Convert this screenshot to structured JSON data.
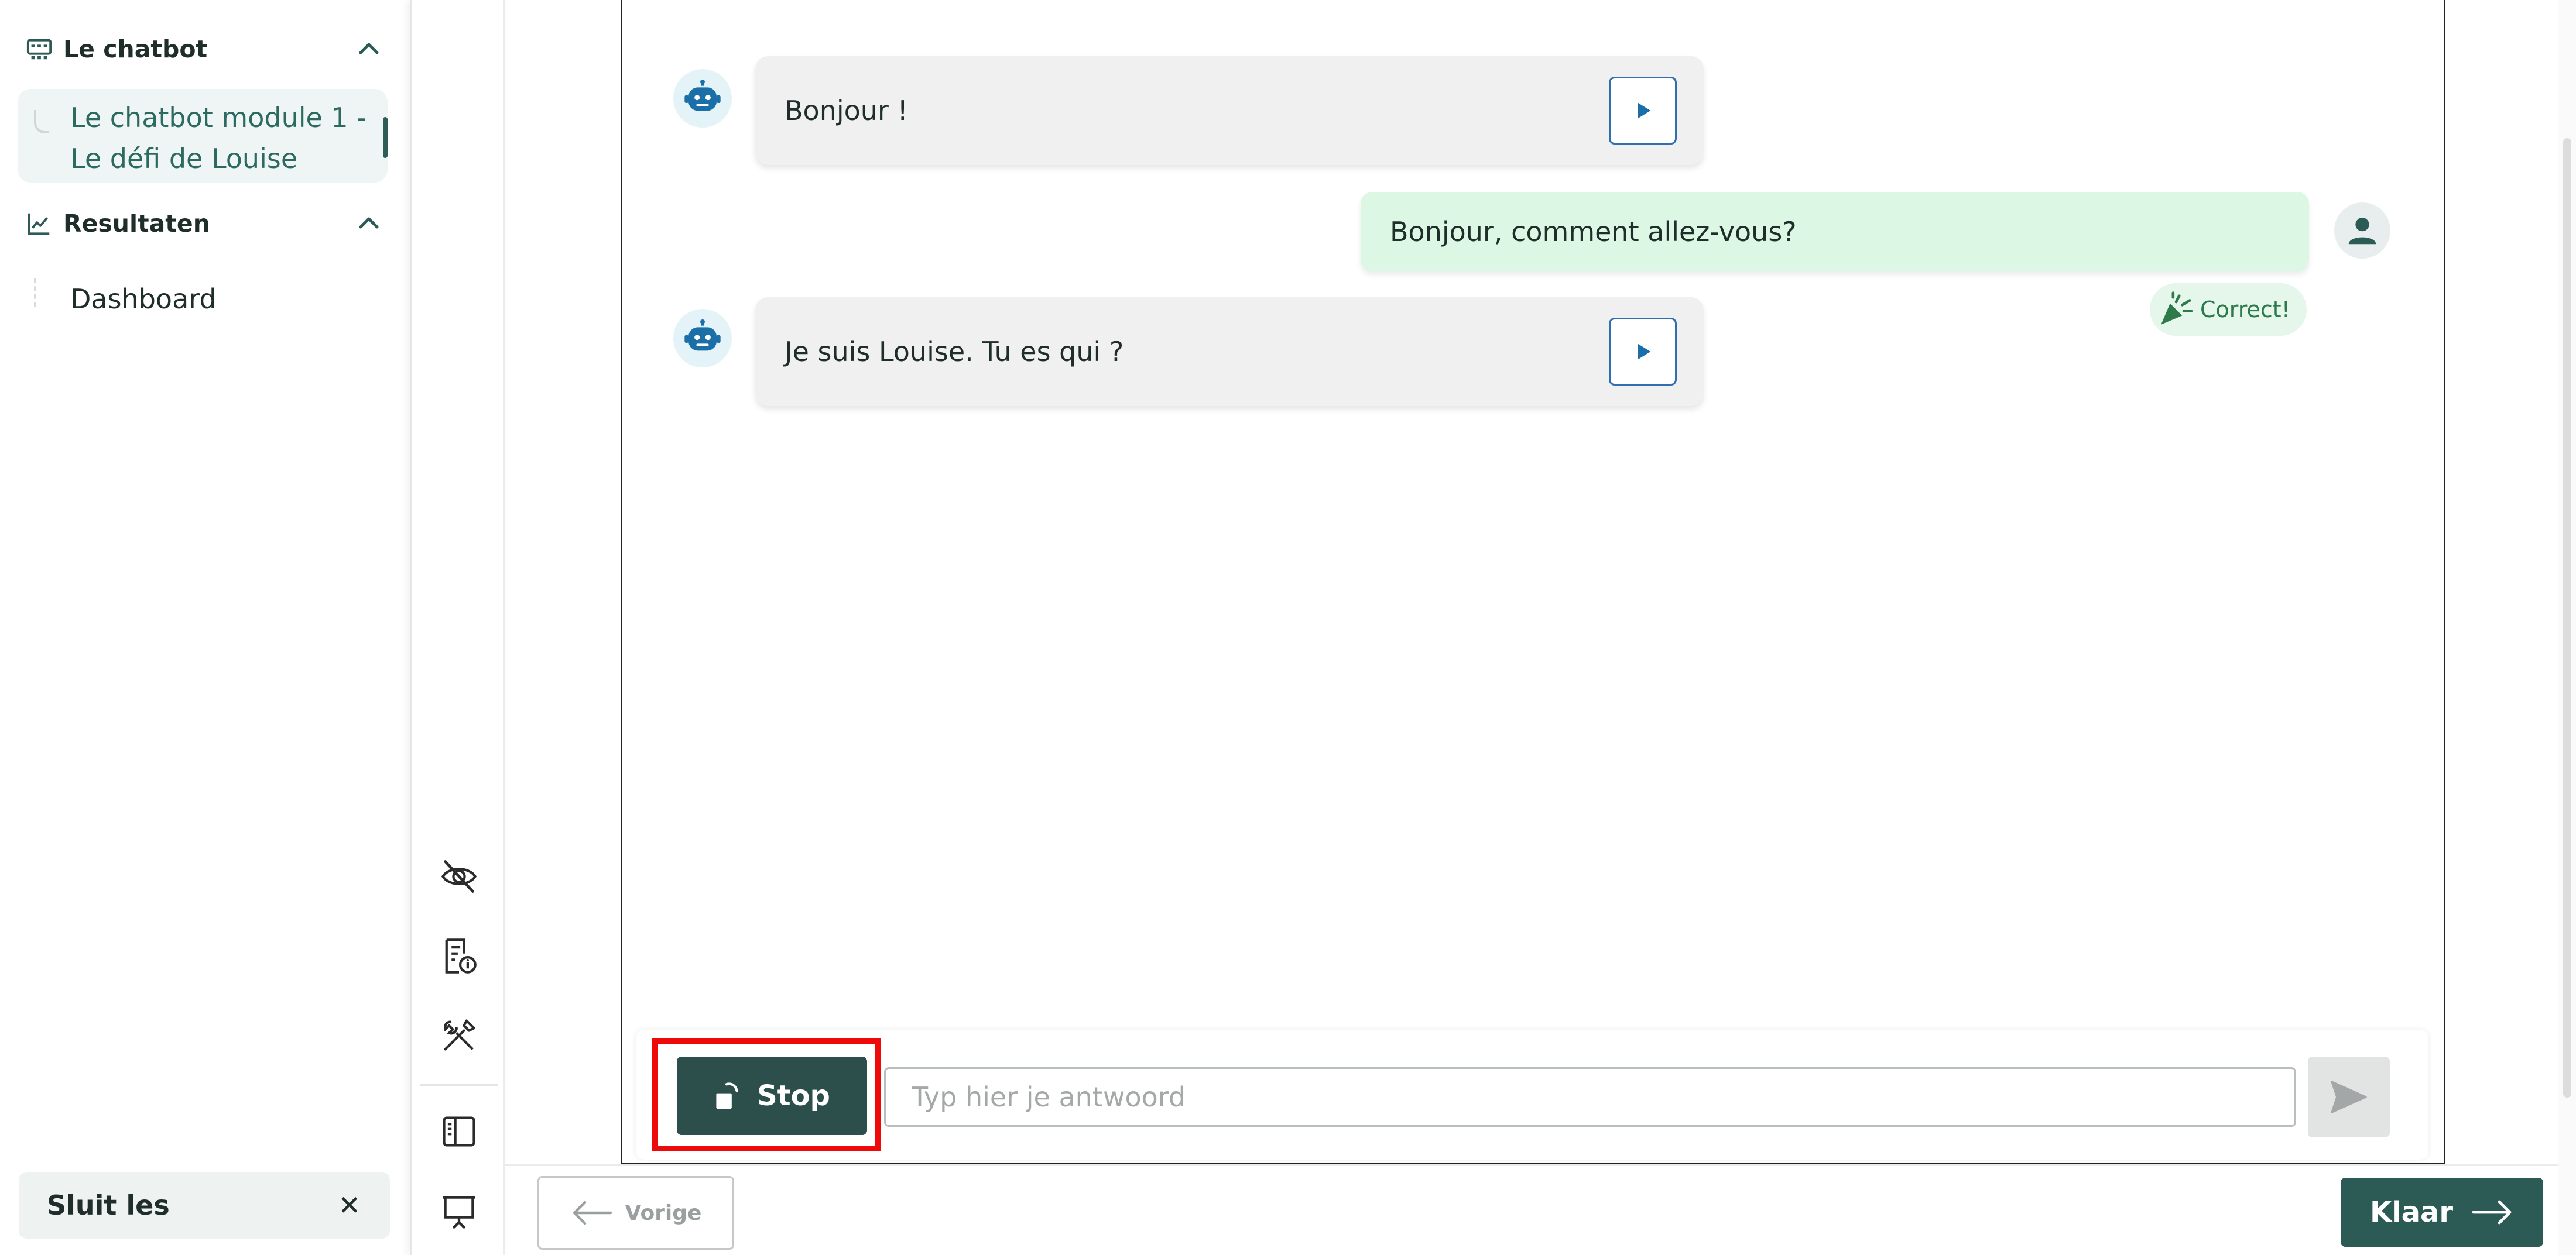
{
  "sidebar": {
    "sections": [
      {
        "title": "Le chatbot",
        "icon": "chatbot-icon",
        "items": [
          {
            "label": "Le chatbot module 1 - Le défi de Louise",
            "active": true
          }
        ]
      },
      {
        "title": "Resultaten",
        "icon": "chart-line-icon",
        "items": [
          {
            "label": "Dashboard",
            "active": false
          }
        ]
      }
    ],
    "close_lesson": {
      "label": "Sluit les",
      "icon": "close-icon"
    }
  },
  "tool_rail": {
    "tools": [
      "eye-off-icon",
      "document-info-icon",
      "tools-icon",
      "sidebar-panel-icon",
      "presentation-icon"
    ]
  },
  "chat": {
    "messages": [
      {
        "role": "bot",
        "text": "Bonjour !",
        "icon": "robot-icon",
        "action_icon": "play-icon"
      },
      {
        "role": "user",
        "text": "Bonjour, comment allez-vous?",
        "icon": "person-icon",
        "feedback": "Correct!",
        "feedback_icon": "party-popper-icon"
      },
      {
        "role": "bot",
        "text": "Je suis Louise. Tu es qui ?",
        "icon": "robot-icon",
        "action_icon": "play-icon"
      }
    ]
  },
  "composer": {
    "stop_label": "Stop",
    "input_value": "",
    "input_placeholder": "Typ hier je antwoord",
    "send_icon": "send-icon"
  },
  "footer": {
    "prev_label": "Vorige",
    "done_label": "Klaar"
  },
  "colors": {
    "brand": "#2c5b55",
    "highlight": "#ee0a0a",
    "bot_bubble": "#eff0ef",
    "user_bubble": "#ddf7e5",
    "link_blue": "#2f6fb0"
  }
}
